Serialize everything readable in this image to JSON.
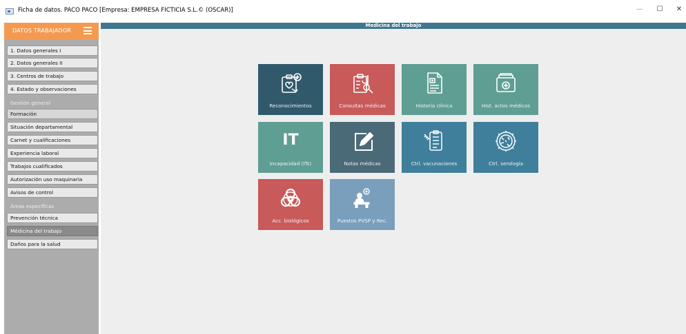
{
  "window": {
    "title": "Ficha de datos. PACO PACO  [Empresa: EMPRESA FICTICIA S.L.© (OSCAR)]",
    "minimize": "—",
    "maximize": "☐",
    "close": "✕"
  },
  "sidebar": {
    "header": "DATOS TRABAJADOR",
    "items_top": [
      "1. Datos generales I",
      "2. Datos generales II",
      "3. Centros de trabajo",
      "4. Estado y observaciones"
    ],
    "group_general": "Gestión general",
    "items_general": [
      "Formación",
      "Situación departamental",
      "Carnet y cualificaciones",
      "Experiencia laboral",
      "Trabajos cualificados",
      "Autorización uso maquinaria",
      "Avisos de control"
    ],
    "group_specific": "Áreas específicas",
    "items_specific": [
      "Prevención técnica",
      "Médicina del trabajo",
      "Daños para la salud"
    ],
    "active_item": "Médicina del trabajo",
    "accent_colors": {
      "prevencion": "#4caf50",
      "medicina": "#2f8fd8",
      "danos": "#e53935"
    }
  },
  "main": {
    "title": "Medicina del trabajo",
    "tiles": [
      {
        "label": "Reconocimientos",
        "icon": "health-check-icon",
        "color": "#305a6c"
      },
      {
        "label": "Consultas médicas",
        "icon": "medical-consult-icon",
        "color": "#c85a5a"
      },
      {
        "label": "Historia clínica",
        "icon": "clinical-history-icon",
        "color": "#5f9e92"
      },
      {
        "label": "Hist. actos médicos",
        "icon": "medical-folder-icon",
        "color": "#5f9e92"
      },
      {
        "label": "Incapacidad (ITs)",
        "icon": "it-text-icon",
        "icon_text": "IT",
        "color": "#5f9e92"
      },
      {
        "label": "Notas médicas",
        "icon": "edit-note-icon",
        "color": "#4b6a78"
      },
      {
        "label": "Ctrl. vacunaciones",
        "icon": "vaccine-list-icon",
        "color": "#3f7f9c"
      },
      {
        "label": "Ctrl. serología",
        "icon": "virus-icon",
        "color": "#3f7f9c"
      },
      {
        "label": "Acc. biológicos",
        "icon": "biohazard-icon",
        "color": "#c85a5a"
      },
      {
        "label": "Puestos PVSP y Rec.",
        "icon": "workstation-icon",
        "color": "#7a9fbc"
      }
    ]
  }
}
